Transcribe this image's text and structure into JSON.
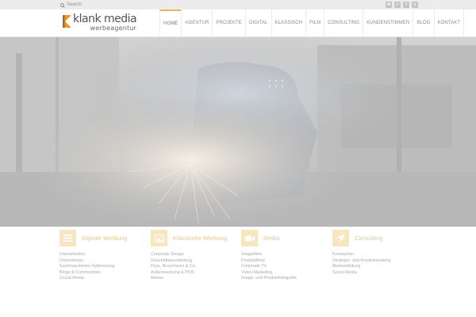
{
  "search": {
    "label": "Search"
  },
  "social": [
    {
      "icon": "mail-icon",
      "glyph": "✉"
    },
    {
      "icon": "twitter-icon",
      "glyph": "t"
    },
    {
      "icon": "facebook-icon",
      "glyph": "f"
    },
    {
      "icon": "xing-icon",
      "glyph": "x"
    }
  ],
  "logo": {
    "name": "klank media",
    "sub": "werbeagentur"
  },
  "nav": [
    "HOME",
    "AGENTUR",
    "PROJEKTE",
    "DIGITAL",
    "KLASSISCH",
    "FILM",
    "CONSULTING",
    "KUNDENSTIMMEN",
    "BLOG",
    "KONTAKT"
  ],
  "colors": {
    "accent": "#f0b44c",
    "icon_bg": "#f8e6bf",
    "title": "#e4c88a"
  },
  "services": [
    {
      "title": "Digitale Werbung",
      "icon": "list-icon",
      "items": [
        "Internetseiten",
        "Onlineshops",
        "Suchmaschinen-Optimierung",
        "Blogs & Communities",
        "Social Media"
      ]
    },
    {
      "title": "Klassische Werbung",
      "icon": "image-icon",
      "items": [
        "Corporate Design",
        "Geschäftsausstattung",
        "Flyer, Broschüren & Co.",
        "Außenwerbung & POS",
        "Messe"
      ]
    },
    {
      "title": "Media",
      "icon": "video-camera-icon",
      "items": [
        "Imagefilme",
        "Produktfilme",
        "Corporate TV",
        "Video-Marketing",
        "Image- und Produktfotografie"
      ]
    },
    {
      "title": "Consulting",
      "icon": "location-arrow-icon",
      "items": [
        "Konzeption",
        "Strategie- und Kreativberatung",
        "Markenbildung",
        "Social Media"
      ]
    }
  ]
}
